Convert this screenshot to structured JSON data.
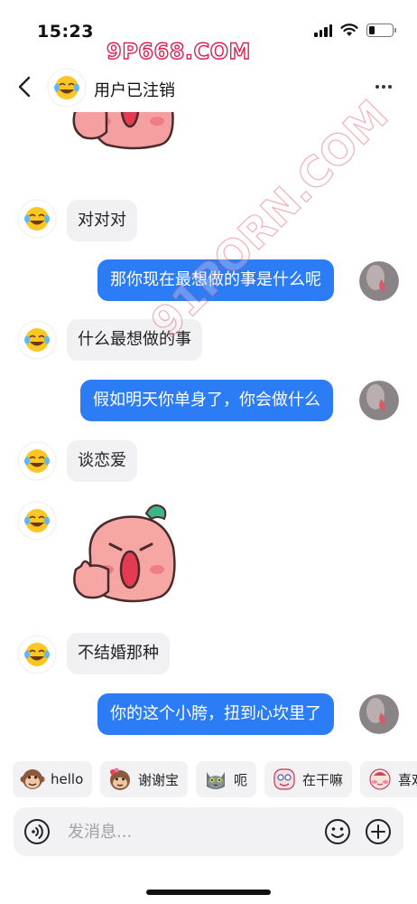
{
  "status_bar": {
    "time": "15:23",
    "battery_level": 0.25
  },
  "watermarks": {
    "top": "9P668.COM",
    "diagonal": "91PORN.COM"
  },
  "header": {
    "title": "用户已注销",
    "avatar": "laughing-emoji-avatar"
  },
  "messages": [
    {
      "side": "in",
      "type": "sticker",
      "name": "peach-thumbs-up-sticker"
    },
    {
      "side": "in",
      "type": "text",
      "text": "对对对"
    },
    {
      "side": "out",
      "type": "text",
      "text": "那你现在最想做的事是什么呢"
    },
    {
      "side": "in",
      "type": "text",
      "text": "什么最想做的事"
    },
    {
      "side": "out",
      "type": "text",
      "text": "假如明天你单身了，你会做什么"
    },
    {
      "side": "in",
      "type": "text",
      "text": "谈恋爱"
    },
    {
      "side": "in",
      "type": "sticker",
      "name": "peach-thumbs-up-sticker"
    },
    {
      "side": "in",
      "type": "text",
      "text": "不结婚那种"
    },
    {
      "side": "out",
      "type": "text",
      "text": "你的这个小胯，扭到心坎里了"
    }
  ],
  "quick_replies": [
    {
      "label": "hello",
      "icon": "monkey-emoji"
    },
    {
      "label": "谢谢宝",
      "icon": "monkey-flower-emoji"
    },
    {
      "label": "呃",
      "icon": "cat-emoji"
    },
    {
      "label": "在干嘛",
      "icon": "peeking-face-emoji"
    },
    {
      "label": "喜欢",
      "icon": "blushing-face-emoji"
    }
  ],
  "input": {
    "placeholder": "发消息..."
  },
  "colors": {
    "outgoing_bubble": "#2c7cf6",
    "incoming_bubble": "#f1f1f3",
    "watermark": "#d9204f"
  }
}
